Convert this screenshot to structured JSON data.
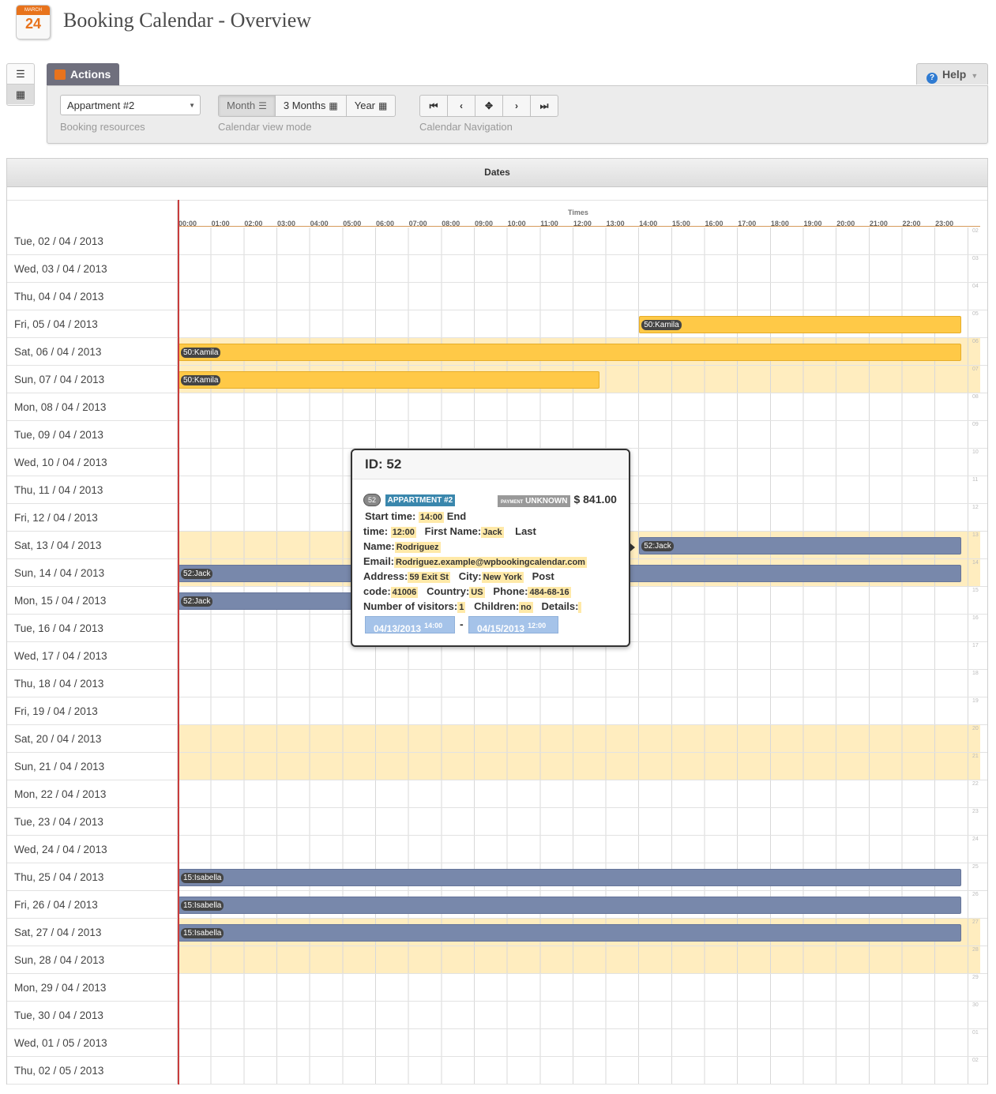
{
  "header": {
    "title": "Booking Calendar - Overview",
    "icon_month": "MARCH",
    "icon_day": "24"
  },
  "toolbar": {
    "tab_label": "Actions",
    "help_label": "Help",
    "resource": {
      "value": "Appartment #2",
      "label": "Booking resources"
    },
    "view_mode": {
      "label": "Calendar view mode",
      "options": [
        "Month",
        "3 Months",
        "Year"
      ],
      "active": "Month"
    },
    "navigation": {
      "label": "Calendar Navigation",
      "buttons": [
        "⏮",
        "‹",
        "✥",
        "›",
        "⏭"
      ]
    }
  },
  "grid": {
    "panel_title": "Dates",
    "times_caption": "Times",
    "hours": [
      "00:00",
      "01:00",
      "02:00",
      "03:00",
      "04:00",
      "05:00",
      "06:00",
      "07:00",
      "08:00",
      "09:00",
      "10:00",
      "11:00",
      "12:00",
      "13:00",
      "14:00",
      "15:00",
      "16:00",
      "17:00",
      "18:00",
      "19:00",
      "20:00",
      "21:00",
      "22:00",
      "23:00"
    ],
    "rows": [
      {
        "date": "Tue, 02 / 04 / 2013",
        "num": "02",
        "weekend": false
      },
      {
        "date": "Wed, 03 / 04 / 2013",
        "num": "03",
        "weekend": false
      },
      {
        "date": "Thu, 04 / 04 / 2013",
        "num": "04",
        "weekend": false
      },
      {
        "date": "Fri, 05 / 04 / 2013",
        "num": "05",
        "weekend": false
      },
      {
        "date": "Sat, 06 / 04 / 2013",
        "num": "06",
        "weekend": true
      },
      {
        "date": "Sun, 07 / 04 / 2013",
        "num": "07",
        "weekend": true
      },
      {
        "date": "Mon, 08 / 04 / 2013",
        "num": "08",
        "weekend": false
      },
      {
        "date": "Tue, 09 / 04 / 2013",
        "num": "09",
        "weekend": false
      },
      {
        "date": "Wed, 10 / 04 / 2013",
        "num": "10",
        "weekend": false
      },
      {
        "date": "Thu, 11 / 04 / 2013",
        "num": "11",
        "weekend": false
      },
      {
        "date": "Fri, 12 / 04 / 2013",
        "num": "12",
        "weekend": false
      },
      {
        "date": "Sat, 13 / 04 / 2013",
        "num": "13",
        "weekend": true
      },
      {
        "date": "Sun, 14 / 04 / 2013",
        "num": "14",
        "weekend": true
      },
      {
        "date": "Mon, 15 / 04 / 2013",
        "num": "15",
        "weekend": false
      },
      {
        "date": "Tue, 16 / 04 / 2013",
        "num": "16",
        "weekend": false
      },
      {
        "date": "Wed, 17 / 04 / 2013",
        "num": "17",
        "weekend": false
      },
      {
        "date": "Thu, 18 / 04 / 2013",
        "num": "18",
        "weekend": false
      },
      {
        "date": "Fri, 19 / 04 / 2013",
        "num": "19",
        "weekend": false
      },
      {
        "date": "Sat, 20 / 04 / 2013",
        "num": "20",
        "weekend": true
      },
      {
        "date": "Sun, 21 / 04 / 2013",
        "num": "21",
        "weekend": true
      },
      {
        "date": "Mon, 22 / 04 / 2013",
        "num": "22",
        "weekend": false
      },
      {
        "date": "Tue, 23 / 04 / 2013",
        "num": "23",
        "weekend": false
      },
      {
        "date": "Wed, 24 / 04 / 2013",
        "num": "24",
        "weekend": false
      },
      {
        "date": "Thu, 25 / 04 / 2013",
        "num": "25",
        "weekend": false
      },
      {
        "date": "Fri, 26 / 04 / 2013",
        "num": "26",
        "weekend": false
      },
      {
        "date": "Sat, 27 / 04 / 2013",
        "num": "27",
        "weekend": true
      },
      {
        "date": "Sun, 28 / 04 / 2013",
        "num": "28",
        "weekend": true
      },
      {
        "date": "Mon, 29 / 04 / 2013",
        "num": "29",
        "weekend": false
      },
      {
        "date": "Tue, 30 / 04 / 2013",
        "num": "30",
        "weekend": false
      },
      {
        "date": "Wed, 01 / 05 / 2013",
        "num": "01",
        "weekend": false
      },
      {
        "date": "Thu, 02 / 05 / 2013",
        "num": "02",
        "weekend": false
      }
    ],
    "bookings": [
      {
        "row": 3,
        "start": 14,
        "end": 24,
        "label": "50:Kamila",
        "color": "yellow"
      },
      {
        "row": 4,
        "start": 0,
        "end": 24,
        "label": "50:Kamila",
        "color": "yellow"
      },
      {
        "row": 5,
        "start": 0,
        "end": 13,
        "label": "50:Kamila",
        "color": "yellow"
      },
      {
        "row": 11,
        "start": 14,
        "end": 24,
        "label": "52:Jack",
        "color": "blue"
      },
      {
        "row": 12,
        "start": 0,
        "end": 24,
        "label": "52:Jack",
        "color": "blue"
      },
      {
        "row": 13,
        "start": 0,
        "end": 12,
        "label": "52:Jack",
        "color": "blue"
      },
      {
        "row": 23,
        "start": 0,
        "end": 24,
        "label": "15:Isabella",
        "color": "blue"
      },
      {
        "row": 24,
        "start": 0,
        "end": 24,
        "label": "15:Isabella",
        "color": "blue"
      },
      {
        "row": 25,
        "start": 0,
        "end": 24,
        "label": "15:Isabella",
        "color": "blue"
      }
    ]
  },
  "popover": {
    "title": "ID: 52",
    "id_badge": "52",
    "resource_badge": "APPARTMENT #2",
    "payment_small": "PAYMENT",
    "payment_status": "UNKNOWN",
    "price": "$ 841.00",
    "labels": {
      "start_time": "Start time:",
      "end": "End",
      "time": "time:",
      "first_name": "First Name:",
      "last": "Last",
      "name": "Name:",
      "email": "Email:",
      "address": "Address:",
      "city": "City:",
      "post": "Post",
      "code": "code:",
      "country": "Country:",
      "phone": "Phone:",
      "visitors": "Number of visitors:",
      "children": "Children:",
      "details": "Details:"
    },
    "values": {
      "start_time": "14:00",
      "end_time": "12:00",
      "first_name": "Jack",
      "last_name": "Rodriguez",
      "email": "Rodriguez.example@wpbookingcalendar.com",
      "address": "59 Exit St",
      "city": "New York",
      "post_code": "41006",
      "country": "US",
      "phone": "484-68-16",
      "visitors": "1",
      "children": "no",
      "details": ""
    },
    "date_from": "04/13/2013",
    "date_from_time": "14:00",
    "date_sep": "-",
    "date_to": "04/15/2013",
    "date_to_time": "12:00"
  }
}
